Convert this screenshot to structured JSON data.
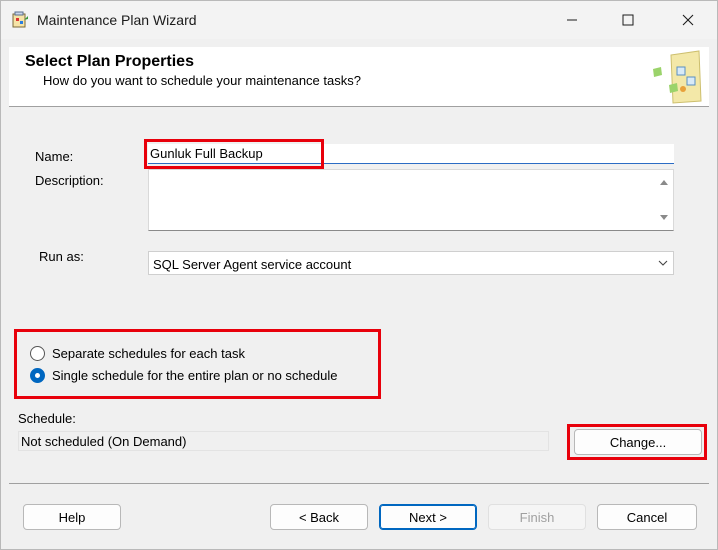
{
  "window": {
    "title": "Maintenance Plan Wizard"
  },
  "header": {
    "title": "Select Plan Properties",
    "subtitle": "How do you want to schedule your maintenance tasks?"
  },
  "form": {
    "name_label": "Name:",
    "name_value": "Gunluk Full Backup",
    "description_label": "Description:",
    "description_value": "",
    "run_as_label": "Run as:",
    "run_as_value": "SQL Server Agent service account"
  },
  "schedule_options": [
    {
      "label": "Separate schedules for each task",
      "selected": false
    },
    {
      "label": "Single schedule for the entire plan or no schedule",
      "selected": true
    }
  ],
  "schedule": {
    "label": "Schedule:",
    "value": "Not scheduled (On Demand)",
    "change_label": "Change..."
  },
  "buttons": {
    "help": "Help",
    "back": "< Back",
    "next": "Next >",
    "finish": "Finish",
    "cancel": "Cancel"
  },
  "colors": {
    "highlight": "#e8000b",
    "accent": "#0067c0"
  }
}
